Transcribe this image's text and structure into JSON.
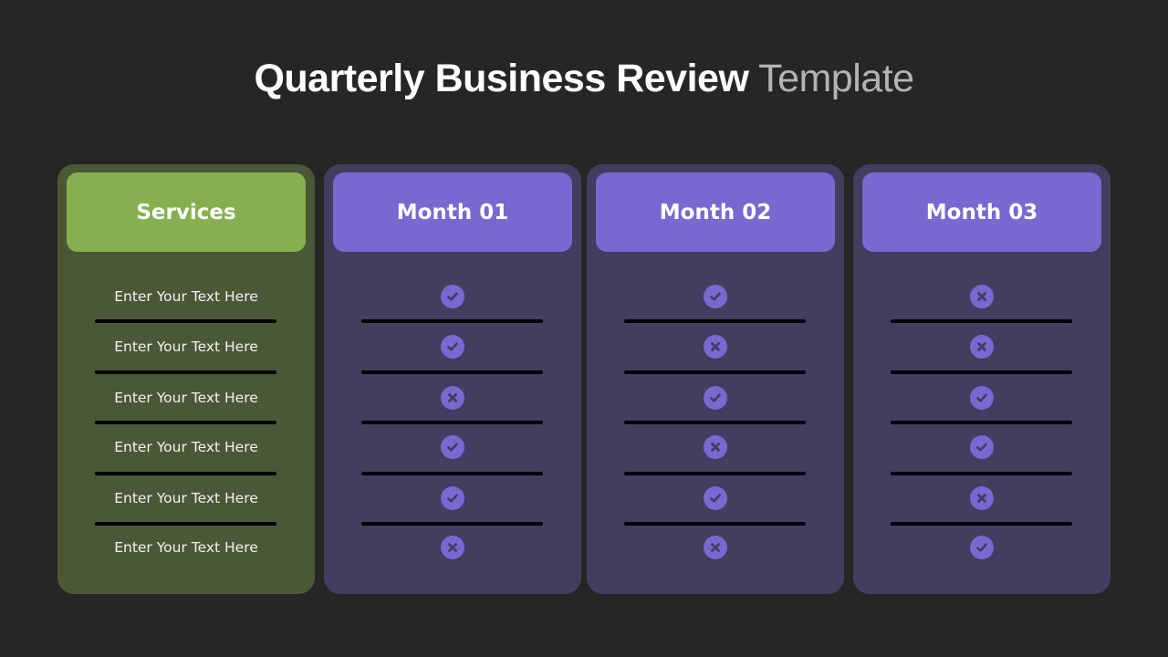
{
  "title": {
    "strong": "Quarterly Business Review",
    "light": "Template"
  },
  "colors": {
    "background": "#262626",
    "services_panel": "#4b5837",
    "services_header": "#86b050",
    "month_panel": "#433d60",
    "month_header": "#7a67d0",
    "status_icon": "#7a67d0"
  },
  "services": {
    "header": "Services",
    "items": [
      "Enter Your Text Here",
      "Enter Your Text Here",
      "Enter Your Text Here",
      "Enter Your Text Here",
      "Enter Your Text Here",
      "Enter Your Text Here"
    ]
  },
  "months": [
    {
      "header": "Month 01",
      "statuses": [
        "check",
        "check",
        "cross",
        "check",
        "check",
        "cross"
      ]
    },
    {
      "header": "Month 02",
      "statuses": [
        "check",
        "cross",
        "check",
        "cross",
        "check",
        "cross"
      ]
    },
    {
      "header": "Month 03",
      "statuses": [
        "cross",
        "cross",
        "check",
        "check",
        "cross",
        "check"
      ]
    }
  ]
}
